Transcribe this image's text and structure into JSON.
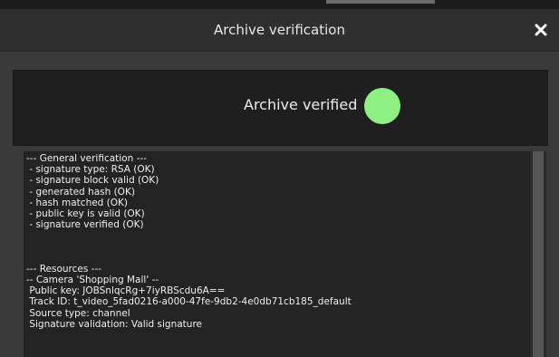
{
  "dialog": {
    "title": "Archive verification",
    "close_icon": "close-icon"
  },
  "status": {
    "text": "Archive verified",
    "indicator_color": "#8ef082"
  },
  "log": {
    "general": [
      "--- General verification ---",
      " - signature type: RSA (OK)",
      " - signature block valid (OK)",
      " - generated hash (OK)",
      " - hash matched (OK)",
      " - public key is valid (OK)",
      " - signature verified (OK)"
    ],
    "resources": [
      "--- Resources ---",
      "-- Camera 'Shopping Mall' --",
      " Public key: JOBSnlqcRg+7iyRBScdu6A==",
      " Track ID: t_video_5fad0216-a000-47fe-9db2-4e0db71cb185_default",
      " Source type: channel",
      " Signature validation: Valid signature"
    ]
  },
  "colors": {
    "success": "#8ef082",
    "background": "#3a3a3a",
    "panel": "#1f1f1f"
  }
}
